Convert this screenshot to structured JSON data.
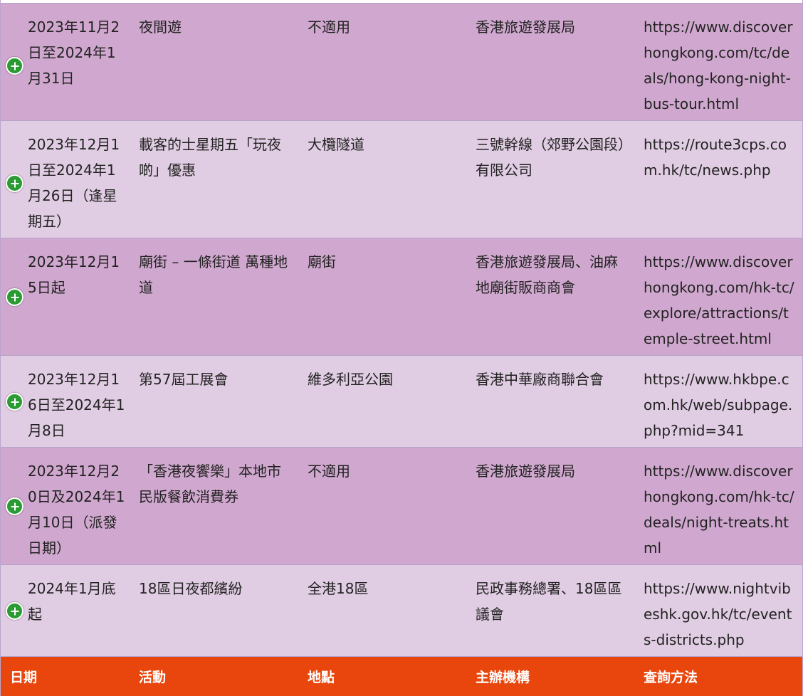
{
  "table": {
    "headers": {
      "date": "日期",
      "activity": "活動",
      "location": "地點",
      "organizer": "主辦機構",
      "url": "查詢方法"
    },
    "rows": [
      {
        "date": "2023年11月2日至2024年1月31日",
        "activity": "夜間遊",
        "location": "不適用",
        "organizer": "香港旅遊發展局",
        "url": "https://www.discoverhongkong.com/tc/deals/hong-kong-night-bus-tour.html"
      },
      {
        "date": "2023年12月1日至2024年1月26日（逢星期五）",
        "activity": "載客的士星期五「玩夜啲」優惠",
        "location": "大欖隧道",
        "organizer": "三號幹線（郊野公園段）有限公司",
        "url": "https://route3cps.com.hk/tc/news.php"
      },
      {
        "date": "2023年12月15日起",
        "activity": "廟街 – 一條街道 萬種地道",
        "location": "廟街",
        "organizer": "香港旅遊發展局、油麻地廟街販商商會",
        "url": "https://www.discoverhongkong.com/hk-tc/explore/attractions/temple-street.html"
      },
      {
        "date": "2023年12月16日至2024年1月8日",
        "activity": "第57屆工展會",
        "location": "維多利亞公園",
        "organizer": "香港中華廠商聯合會",
        "url": "https://www.hkbpe.com.hk/web/subpage.php?mid=341"
      },
      {
        "date": "2023年12月20日及2024年1月10日（派發日期）",
        "activity": "「香港夜饗樂」本地市民版餐飲消費券",
        "location": "不適用",
        "organizer": "香港旅遊發展局",
        "url": "https://www.discoverhongkong.com/hk-tc/deals/night-treats.html"
      },
      {
        "date": "2024年1月底起",
        "activity": "18區日夜都繽紛",
        "location": "全港18區",
        "organizer": "民政事務總署、18區區議會",
        "url": "https://www.nightvibeshk.gov.hk/tc/events-districts.php"
      }
    ]
  }
}
